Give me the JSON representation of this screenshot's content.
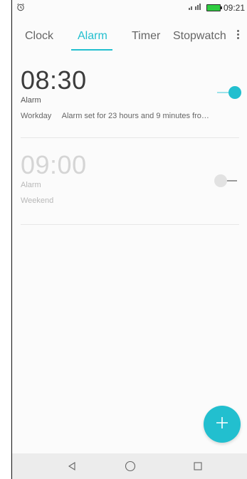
{
  "status_bar": {
    "time": "09:21",
    "icons": [
      "alarm-icon",
      "signal-icon",
      "battery-icon"
    ]
  },
  "tabs": [
    {
      "label": "Clock",
      "active": false
    },
    {
      "label": "Alarm",
      "active": true
    },
    {
      "label": "Timer",
      "active": false
    },
    {
      "label": "Stopwatch",
      "active": false
    }
  ],
  "alarms": [
    {
      "time": "08:30",
      "label": "Alarm",
      "repeat": "Workday",
      "note": "Alarm set for 23 hours and 9 minutes fro…",
      "enabled": true
    },
    {
      "time": "09:00",
      "label": "Alarm",
      "repeat": "Weekend",
      "note": "",
      "enabled": false
    }
  ],
  "colors": {
    "accent": "#22bfcf"
  }
}
